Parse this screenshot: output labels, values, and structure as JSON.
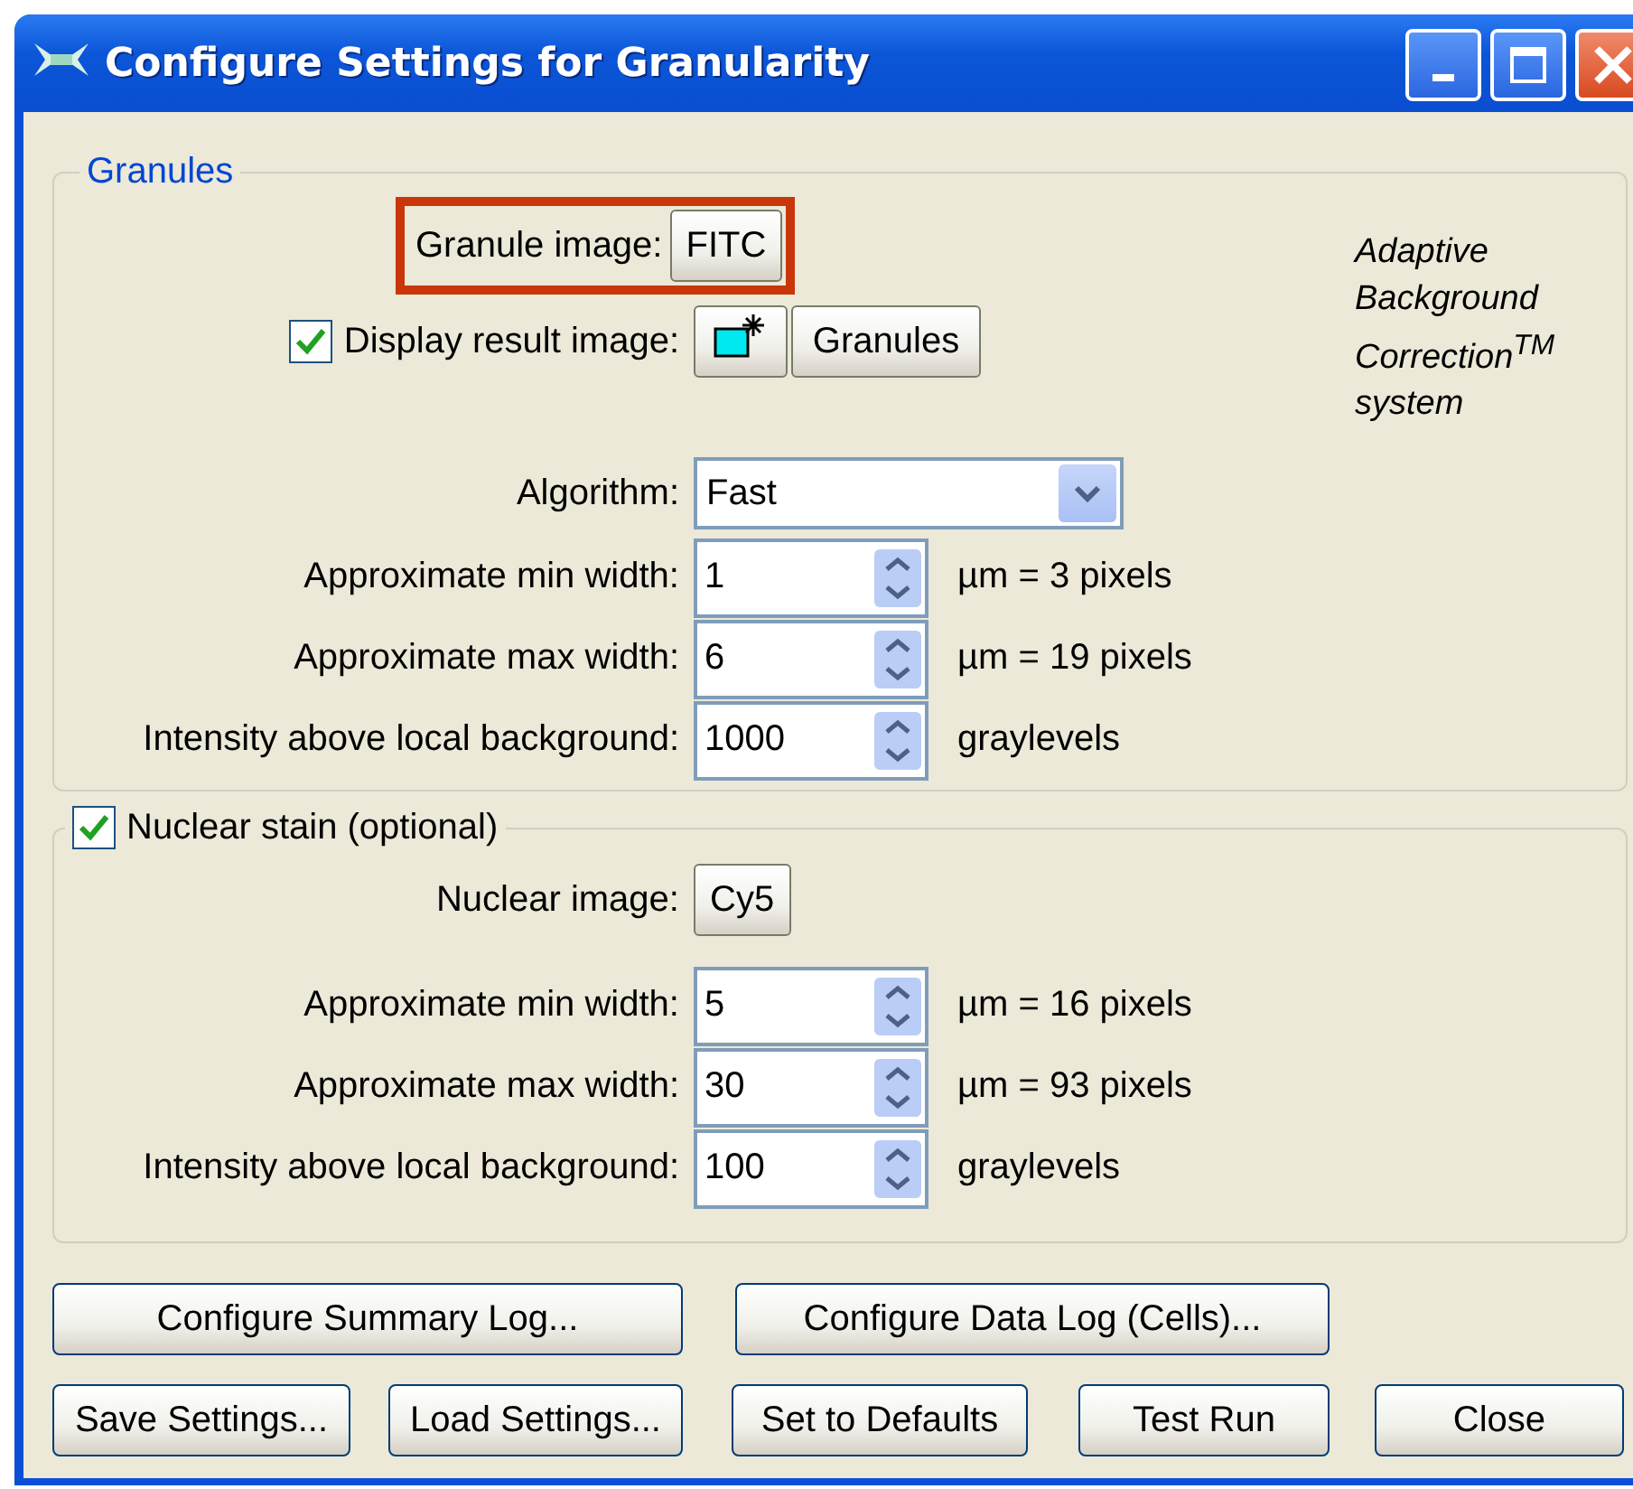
{
  "window": {
    "title": "Configure Settings for Granularity"
  },
  "granules": {
    "title": "Granules",
    "granule_image": {
      "label": "Granule image:",
      "value": "FITC",
      "highlighted": true
    },
    "display_result": {
      "label": "Display result image:",
      "checked": true,
      "button": "Granules"
    },
    "note": "Adaptive Background Correction$^{TM}$ system",
    "algorithm": {
      "label": "Algorithm:",
      "value": "Fast"
    },
    "fields": [
      {
        "label": "Approximate min width:",
        "value": "1",
        "unit": "µm = 3 pixels"
      },
      {
        "label": "Approximate max width:",
        "value": "6",
        "unit": "µm = 19 pixels"
      },
      {
        "label": "Intensity above local background:",
        "value": "1000",
        "unit": "graylevels"
      }
    ]
  },
  "nuclear": {
    "title": "Nuclear stain (optional)",
    "checked": true,
    "image": {
      "label": "Nuclear image:",
      "value": "Cy5"
    },
    "fields": [
      {
        "label": "Approximate min width:",
        "value": "5",
        "unit": "µm = 16 pixels"
      },
      {
        "label": "Approximate max width:",
        "value": "30",
        "unit": "µm = 93 pixels"
      },
      {
        "label": "Intensity above local background:",
        "value": "100",
        "unit": "graylevels"
      }
    ]
  },
  "buttons": [
    [
      "Configure Summary Log...",
      "Configure Data Log (Cells)..."
    ],
    [
      "Save Settings...",
      "Load Settings...",
      "Set to Defaults",
      "Test Run",
      "Close"
    ]
  ]
}
